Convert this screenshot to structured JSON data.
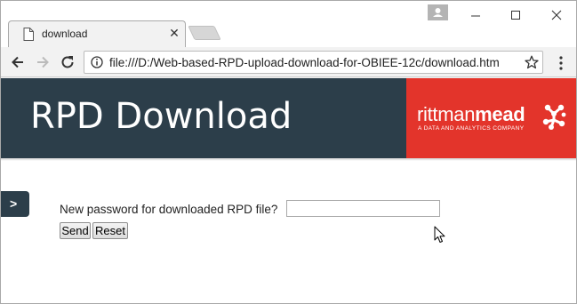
{
  "browser": {
    "tab_title": "download",
    "tab_close": "✕",
    "url": "file:///D:/Web-based-RPD-upload-download-for-OBIEE-12c/download.htm",
    "icons": {
      "favicon": "document-icon",
      "profile": "profile-icon",
      "back": "back-arrow-icon",
      "forward": "forward-arrow-icon",
      "reload": "reload-icon",
      "info": "info-icon",
      "bookmark": "star-icon",
      "menu": "kebab-menu-icon"
    }
  },
  "banner": {
    "title": "RPD Download",
    "brand_light": "rittman",
    "brand_bold": "mead",
    "brand_tagline": "A DATA AND ANALYTICS COMPANY",
    "colors": {
      "banner_bg": "#2c3e4a",
      "brand_bg": "#e3342b"
    }
  },
  "sidebar": {
    "toggle_label": ">"
  },
  "form": {
    "label": "New password for downloaded RPD file?",
    "password_value": "",
    "send_label": "Send",
    "reset_label": "Reset"
  }
}
